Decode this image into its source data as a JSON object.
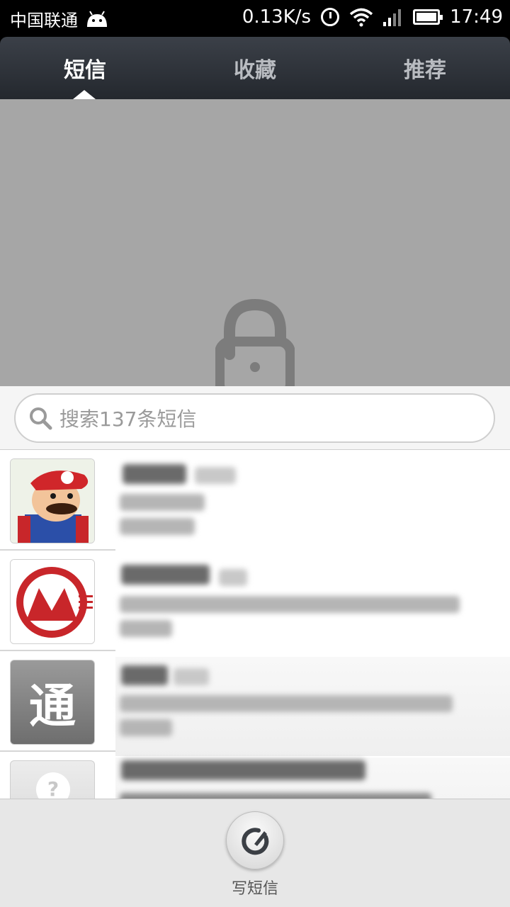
{
  "status_bar": {
    "carrier": "中国联通",
    "speed": "0.13K/s",
    "time": "17:49",
    "icons": [
      "android-icon",
      "alarm-icon",
      "wifi-icon",
      "signal-icon",
      "battery-icon"
    ]
  },
  "tabs": [
    {
      "label": "短信",
      "active": true
    },
    {
      "label": "收藏",
      "active": false
    },
    {
      "label": "推荐",
      "active": false
    }
  ],
  "lock": {
    "icon": "unlock-icon"
  },
  "search": {
    "placeholder": "搜索137条短信"
  },
  "conversations": [
    {
      "avatar": "mario-avatar"
    },
    {
      "avatar": "cmb-logo-avatar"
    },
    {
      "avatar": "unicom-avatar",
      "avatar_text": "通"
    },
    {
      "avatar": "unknown-contact-avatar"
    }
  ],
  "bottom": {
    "compose_label": "写短信"
  },
  "colors": {
    "tab_bar": "#2c3036",
    "lock_area": "#a6a6a6",
    "bottom_bar": "#e7e7e7"
  }
}
